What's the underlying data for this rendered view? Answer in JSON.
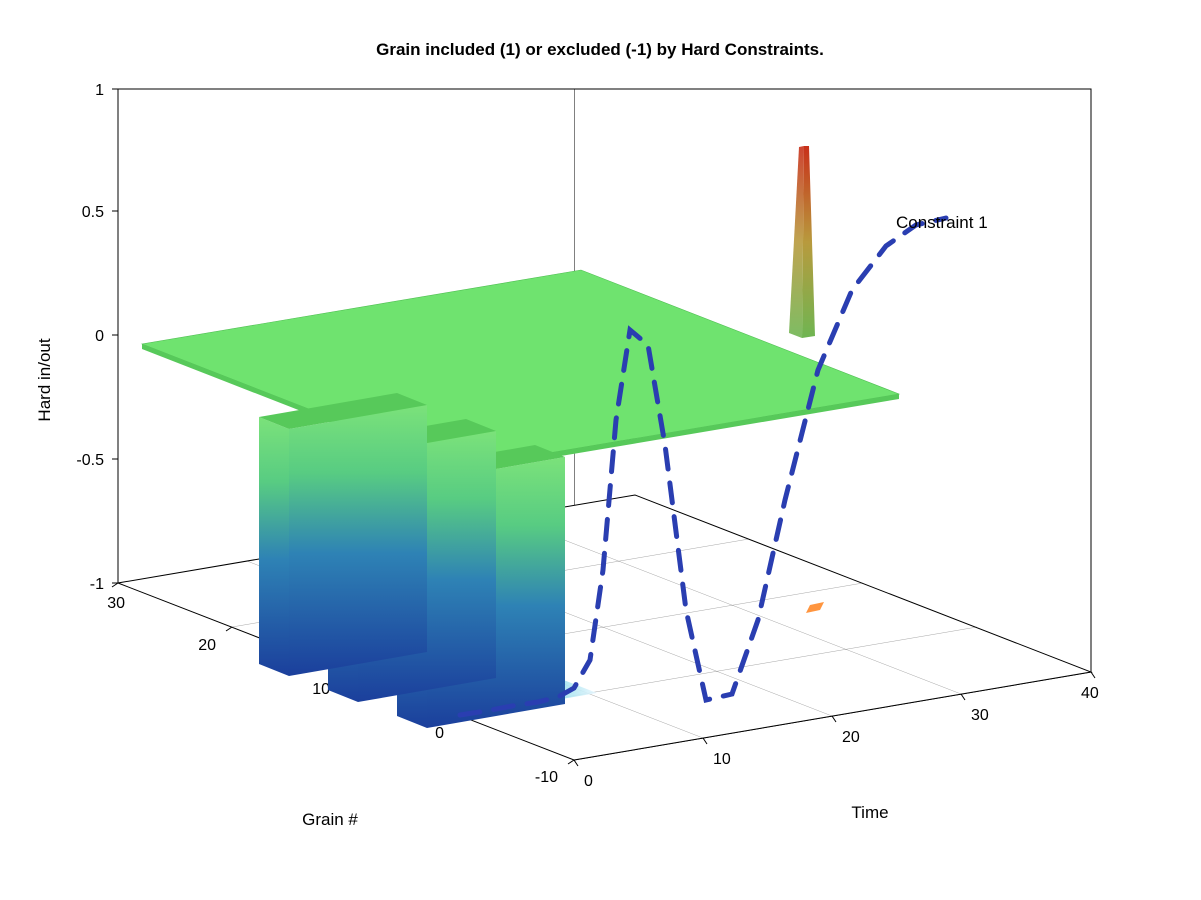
{
  "chart_data": {
    "type": "surface3d",
    "title": "Grain included (1) or excluded (-1) by Hard Constraints.",
    "xlabel": "Time",
    "ylabel": "Grain #",
    "zlabel": "Hard in/out",
    "xlim": [
      0,
      40
    ],
    "ylim": [
      -10,
      30
    ],
    "zlim": [
      -1,
      1
    ],
    "xticks": [
      0,
      10,
      20,
      30,
      40
    ],
    "yticks": [
      -10,
      0,
      10,
      20,
      30
    ],
    "zticks": [
      -1,
      -0.5,
      0,
      0.5,
      1
    ],
    "surface_description": "Z is mostly 0 over Time×Grain; three narrow bands at approx Grain ≈ 3, 9, 15 drop to -1 for Time roughly 0–10; a single narrow spike near Time ≈ 27, Grain ≈ 22 rises close to +1.",
    "neg_bands_grain": [
      3,
      9,
      15
    ],
    "neg_band_time_range": [
      0,
      10
    ],
    "neg_band_value": -1,
    "spike": {
      "time": 27,
      "grain": 22,
      "value": 0.9
    },
    "annotations": [
      {
        "text": "Constraint 1",
        "near": "spike"
      }
    ],
    "series": [
      {
        "name": "Constraint 1",
        "style": "dashed",
        "color": "#2a3eb1",
        "plane": "grain=0",
        "x": [
          0,
          2,
          4,
          6,
          8,
          10,
          12,
          14,
          16,
          18,
          20,
          22,
          24,
          26,
          28,
          30,
          32
        ],
        "z": [
          -1.0,
          -1.0,
          -1.0,
          -0.98,
          -0.9,
          -0.6,
          0.2,
          0.65,
          0.3,
          -0.6,
          -1.0,
          -0.6,
          0.1,
          0.55,
          0.8,
          0.85,
          0.8
        ]
      }
    ],
    "colormap": "jet_like",
    "colors": {
      "surface_top": "#6fe36f",
      "surface_deep": "#1b3f9c",
      "spike_top": "#c8301a",
      "dash": "#2a3eb1",
      "axis": "#000000",
      "back_panel": "#ffffff"
    }
  }
}
